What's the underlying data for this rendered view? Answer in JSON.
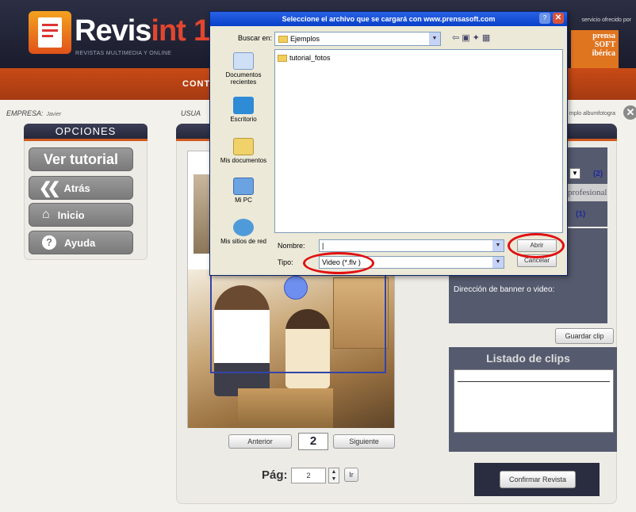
{
  "header": {
    "brand_main": "Revis",
    "brand_accent": "int",
    "brand_number": "1",
    "tagline": "REVISTAS MULTIMEDIA Y ONLINE",
    "service_text": "servicio ofrecido por",
    "partner_logo": "prensa SOFT ibérica"
  },
  "nav": {
    "item": "CONT"
  },
  "info": {
    "empresa_label": "EMPRESA:",
    "empresa_value": "Javier",
    "usuario_label": "USUA",
    "album_text": "mplo albumfotogra"
  },
  "options": {
    "title": "OPCIONES",
    "tutorial": "Ver tutorial",
    "atras": "Atrás",
    "inicio": "Inicio",
    "ayuda": "Ayuda"
  },
  "pager": {
    "anterior": "Anterior",
    "current": "2",
    "siguiente": "Siguiente",
    "pag_label": "Pág:",
    "pag_value": "2",
    "go": "Ir"
  },
  "right": {
    "num_top": "(2)",
    "profesional": "profesional",
    "num_mid": "(1)",
    "banner_label": "Dirección de banner o video:",
    "guardar": "Guardar clip",
    "clips_title": "Listado de clips",
    "confirmar": "Confirmar Revista"
  },
  "dialog": {
    "title": "Seleccione el archivo que se cargará con www.prensasoft.com",
    "buscar_label": "Buscar en:",
    "buscar_value": "Ejemplos",
    "places": [
      {
        "label": "Documentos recientes"
      },
      {
        "label": "Escritorio"
      },
      {
        "label": "Mis documentos"
      },
      {
        "label": "Mi PC"
      },
      {
        "label": "Mis sitios de red"
      }
    ],
    "files": [
      "tutorial_fotos"
    ],
    "nombre_label": "Nombre:",
    "nombre_value": "",
    "tipo_label": "Tipo:",
    "tipo_value": "Video (*.flv )",
    "abrir": "Abrir",
    "cancelar": "Cancelar"
  },
  "colors": {
    "header_bg": "#1f2233",
    "nav_orange": "#b8441a",
    "panel_dark": "#555a6e",
    "highlight_red": "#e01010"
  }
}
